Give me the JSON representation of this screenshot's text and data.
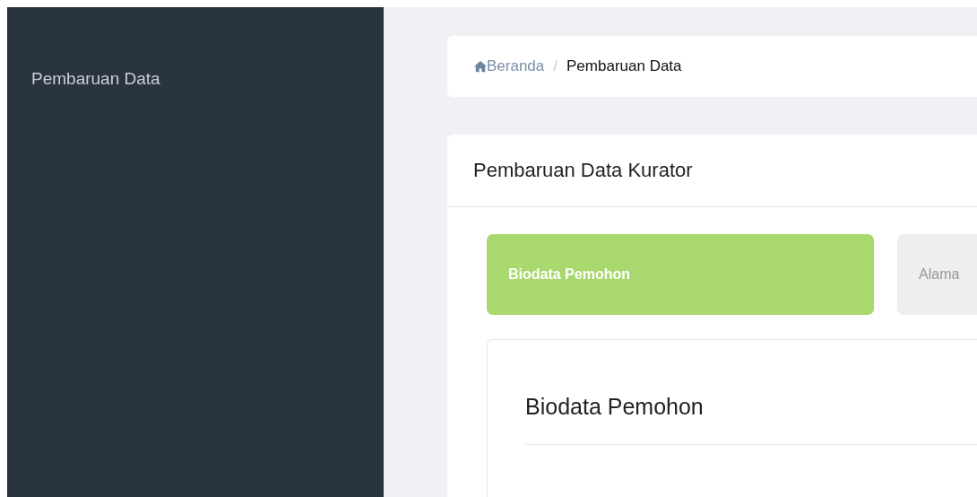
{
  "sidebar": {
    "items": [
      {
        "label": "Pembaruan Data"
      }
    ]
  },
  "breadcrumb": [
    {
      "label": "Beranda"
    },
    {
      "label": "Pembaruan Data"
    }
  ],
  "breadcrumb_separator": "/",
  "card": {
    "title": "Pembaruan Data Kurator"
  },
  "tabs": [
    {
      "label": "Biodata Pemohon",
      "selected": true
    },
    {
      "label": "Alama",
      "selected": false
    }
  ],
  "section": {
    "title": "Biodata Pemohon"
  }
}
